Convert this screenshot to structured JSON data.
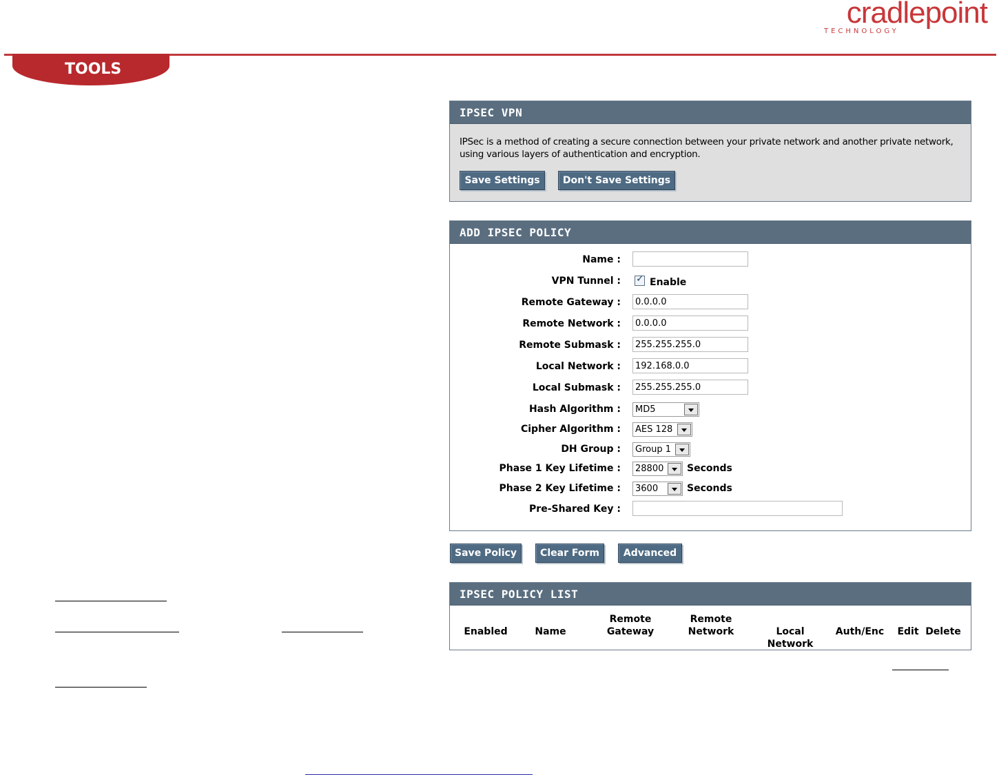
{
  "brand": {
    "name": "cradlepoint",
    "tagline": "TECHNOLOGY"
  },
  "tab": {
    "label": "TOOLS"
  },
  "vpn_panel": {
    "title": "IPSEC VPN",
    "description": "IPSec is a method of creating a secure connection between your private network and another private network, using various layers of authentication and encryption.",
    "save_label": "Save Settings",
    "dont_save_label": "Don't Save Settings"
  },
  "policy_panel": {
    "title": "ADD IPSEC POLICY",
    "name_label": "Name :",
    "name_value": "",
    "vpn_tunnel_label": "VPN Tunnel :",
    "vpn_tunnel_checked": true,
    "vpn_tunnel_option": "Enable",
    "remote_gateway_label": "Remote Gateway :",
    "remote_gateway_value": "0.0.0.0",
    "remote_network_label": "Remote Network :",
    "remote_network_value": "0.0.0.0",
    "remote_submask_label": "Remote Submask :",
    "remote_submask_value": "255.255.255.0",
    "local_network_label": "Local Network :",
    "local_network_value": "192.168.0.0",
    "local_submask_label": "Local Submask :",
    "local_submask_value": "255.255.255.0",
    "hash_label": "Hash Algorithm :",
    "hash_value": "MD5",
    "cipher_label": "Cipher Algorithm :",
    "cipher_value": "AES 128",
    "dh_label": "DH Group :",
    "dh_value": "Group 1",
    "phase1_label": "Phase 1 Key Lifetime :",
    "phase1_value": "28800",
    "phase1_unit": "Seconds",
    "phase2_label": "Phase 2 Key Lifetime :",
    "phase2_value": "3600",
    "phase2_unit": "Seconds",
    "psk_label": "Pre-Shared Key :",
    "psk_value": ""
  },
  "actions": {
    "save_policy": "Save Policy",
    "clear_form": "Clear Form",
    "advanced": "Advanced"
  },
  "list_panel": {
    "title": "IPSEC POLICY LIST",
    "columns": [
      "Enabled",
      "Name",
      "Remote\nGateway",
      "Remote\nNetwork",
      "Local Network",
      "Auth/Enc",
      "Edit",
      "Delete"
    ]
  }
}
